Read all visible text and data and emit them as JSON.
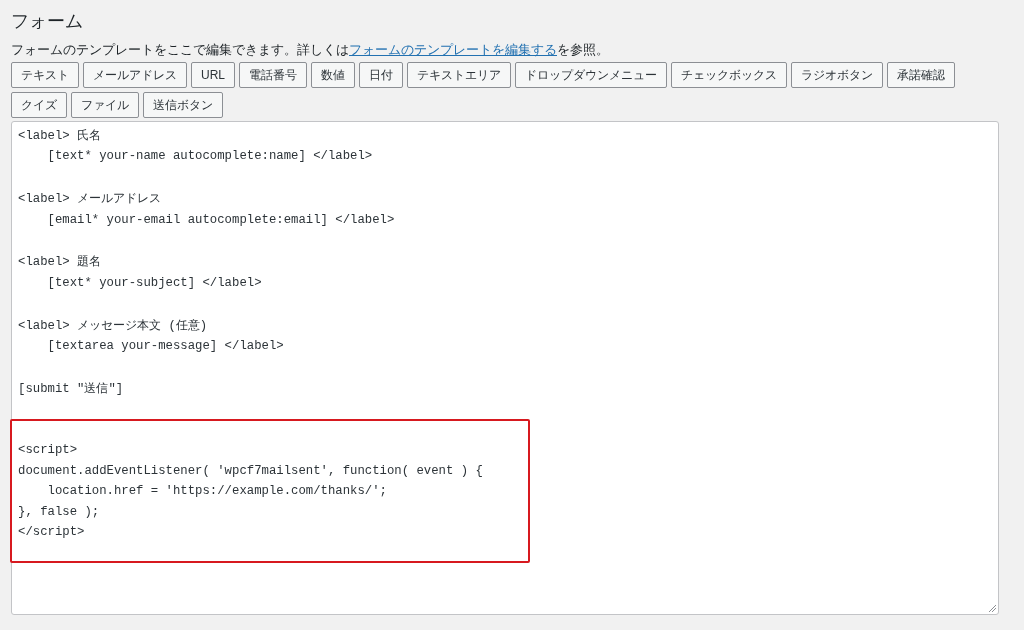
{
  "title": "フォーム",
  "description": {
    "before": "フォームのテンプレートをここで編集できます。詳しくは",
    "link": "フォームのテンプレートを編集する",
    "after": "を参照。"
  },
  "tag_buttons": [
    [
      "テキスト",
      "メールアドレス",
      "URL",
      "電話番号",
      "数値",
      "日付",
      "テキストエリア",
      "ドロップダウンメニュー",
      "チェックボックス",
      "ラジオボタン",
      "承諾確認"
    ],
    [
      "クイズ",
      "ファイル",
      "送信ボタン"
    ]
  ],
  "editor": {
    "blocks": [
      {
        "highlighted": false,
        "lines": [
          "<label> 氏名",
          "    [text* your-name autocomplete:name] </label>"
        ]
      },
      {
        "highlighted": false,
        "lines": [
          "<label> メールアドレス",
          "    [email* your-email autocomplete:email] </label>"
        ]
      },
      {
        "highlighted": false,
        "lines": [
          "<label> 題名",
          "    [text* your-subject] </label>"
        ]
      },
      {
        "highlighted": false,
        "lines": [
          "<label> メッセージ本文 (任意)",
          "    [textarea your-message] </label>"
        ]
      },
      {
        "highlighted": false,
        "lines": [
          "[submit \"送信\"]"
        ]
      },
      {
        "highlighted": true,
        "lines": [
          "<script>",
          "document.addEventListener( 'wpcf7mailsent', function( event ) {",
          "    location.href = 'https://example.com/thanks/';",
          "}, false );",
          "</script>"
        ]
      }
    ]
  }
}
